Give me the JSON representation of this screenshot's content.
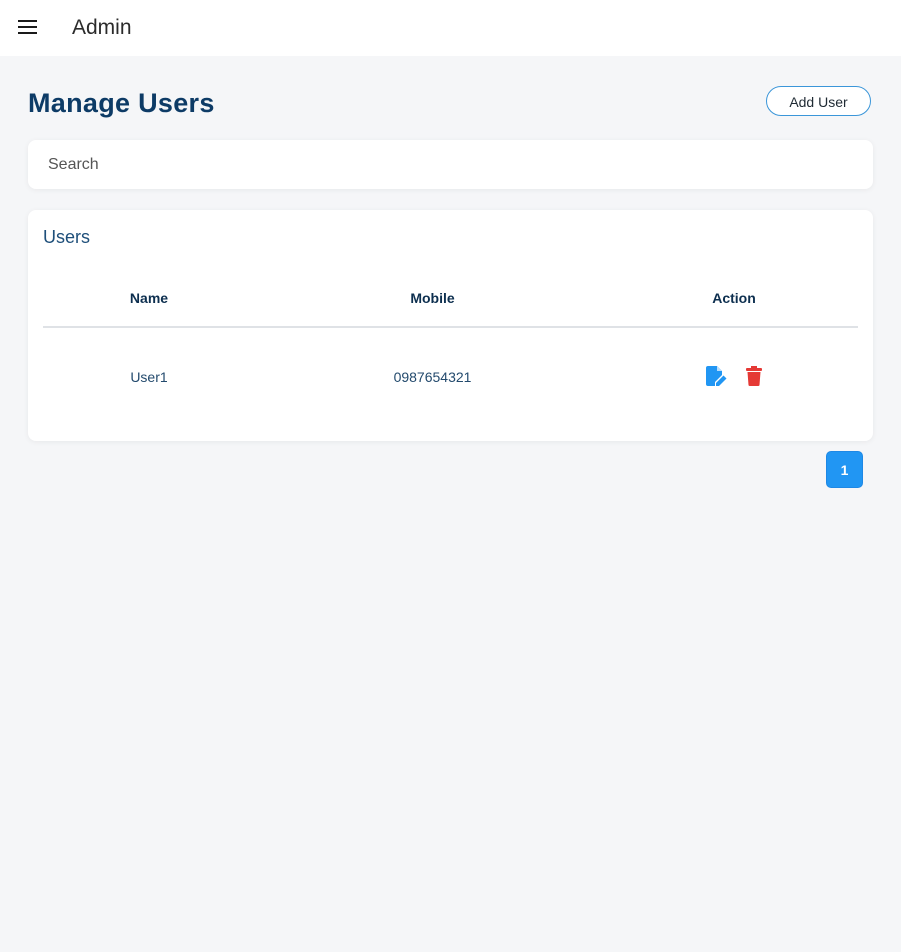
{
  "topbar": {
    "menu_icon": "hamburger-menu-icon",
    "title": "Admin"
  },
  "page": {
    "title": "Manage Users",
    "add_button_label": "Add User"
  },
  "search": {
    "placeholder": "Search",
    "value": ""
  },
  "users_card": {
    "title": "Users",
    "columns": [
      "Name",
      "Mobile",
      "Action"
    ],
    "rows": [
      {
        "name": "User1",
        "mobile": "0987654321",
        "actions": [
          {
            "icon": "edit-icon",
            "color": "#2196f3"
          },
          {
            "icon": "trash-icon",
            "color": "#e53935"
          }
        ]
      }
    ]
  },
  "pagination": {
    "pages": [
      "1"
    ],
    "current": "1"
  },
  "colors": {
    "accent": "#2196f3",
    "heading": "#0d3b66",
    "danger": "#e53935",
    "background": "#f5f6f8"
  }
}
